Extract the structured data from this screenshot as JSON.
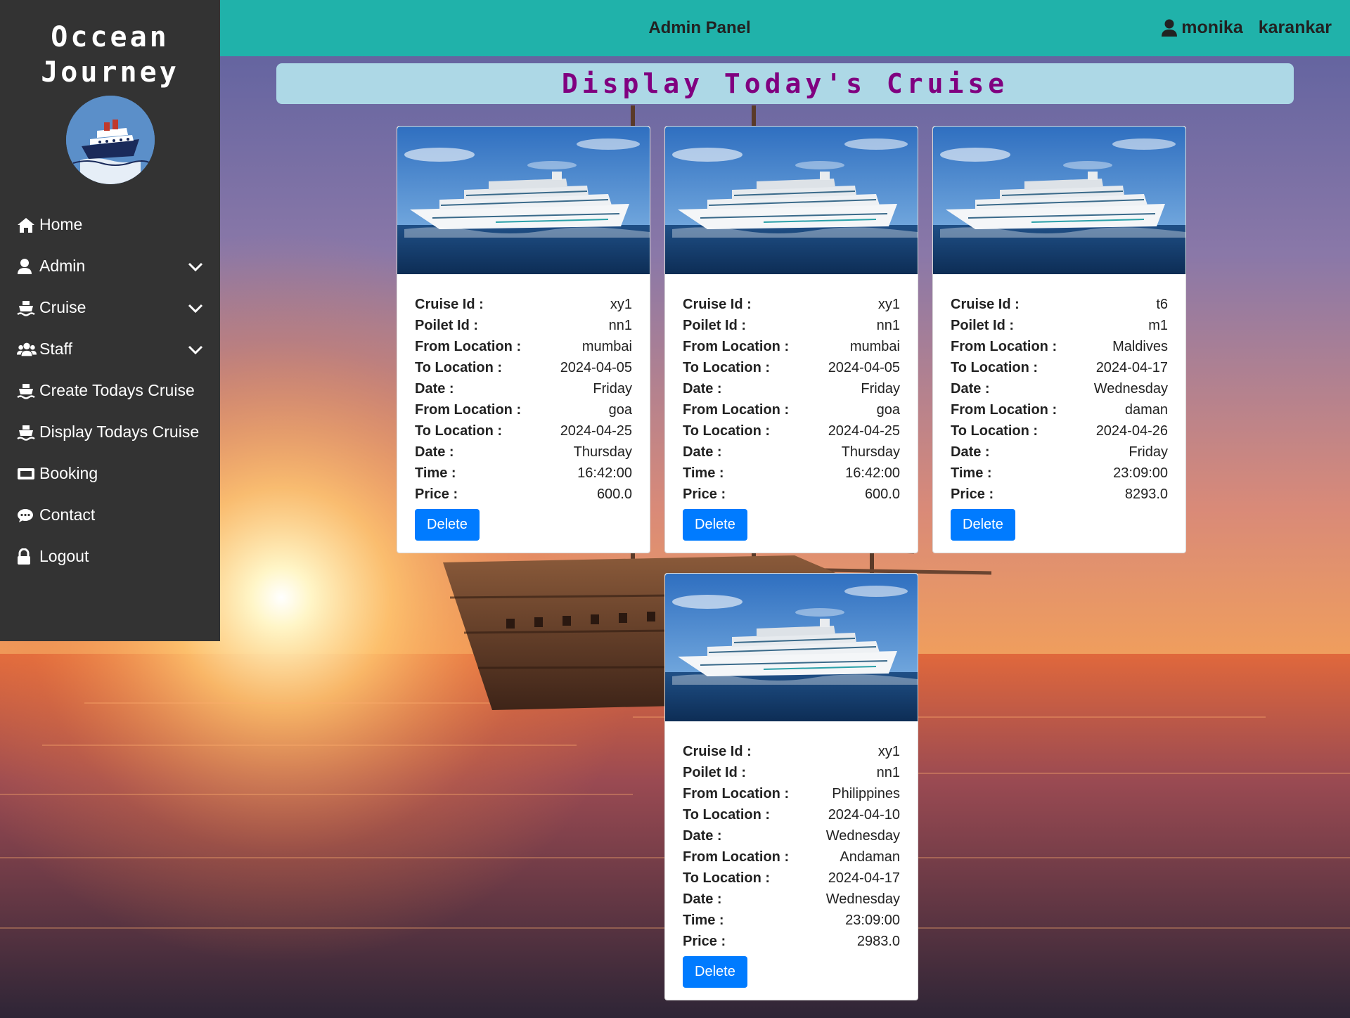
{
  "brand": {
    "line1": "Occean",
    "line2": "Journey"
  },
  "nav": [
    {
      "label": "Home",
      "icon": "home-icon",
      "dropdown": false
    },
    {
      "label": "Admin",
      "icon": "user-icon",
      "dropdown": true
    },
    {
      "label": "Cruise",
      "icon": "ship-icon",
      "dropdown": true
    },
    {
      "label": "Staff",
      "icon": "users-icon",
      "dropdown": true
    },
    {
      "label": "Create Todays Cruise",
      "icon": "ship-icon",
      "dropdown": false
    },
    {
      "label": "Display Todays Cruise",
      "icon": "ship-icon",
      "dropdown": false
    },
    {
      "label": "Booking",
      "icon": "ticket-icon",
      "dropdown": false
    },
    {
      "label": "Contact",
      "icon": "chat-icon",
      "dropdown": false
    },
    {
      "label": "Logout",
      "icon": "lock-icon",
      "dropdown": false
    }
  ],
  "topbar": {
    "title": "Admin Panel",
    "user_first": "monika",
    "user_last": "karankar"
  },
  "page": {
    "heading": "Display Today's Cruise"
  },
  "labels": {
    "cruise_id": "Cruise Id :",
    "poilet_id": "Poilet Id :",
    "from_location": "From Location :",
    "to_location": "To Location :",
    "date": "Date :",
    "time": "Time :",
    "price": "Price :",
    "delete": "Delete"
  },
  "cruises": [
    {
      "cruise_id": "xy1",
      "poilet_id": "nn1",
      "from1": "mumbai",
      "to1": "2024-04-05",
      "date1": "Friday",
      "from2": "goa",
      "to2": "2024-04-25",
      "date2": "Thursday",
      "time": "16:42:00",
      "price": "600.0"
    },
    {
      "cruise_id": "xy1",
      "poilet_id": "nn1",
      "from1": "mumbai",
      "to1": "2024-04-05",
      "date1": "Friday",
      "from2": "goa",
      "to2": "2024-04-25",
      "date2": "Thursday",
      "time": "16:42:00",
      "price": "600.0"
    },
    {
      "cruise_id": "t6",
      "poilet_id": "m1",
      "from1": "Maldives",
      "to1": "2024-04-17",
      "date1": "Wednesday",
      "from2": "daman",
      "to2": "2024-04-26",
      "date2": "Friday",
      "time": "23:09:00",
      "price": "8293.0"
    },
    {
      "cruise_id": "xy1",
      "poilet_id": "nn1",
      "from1": "Philippines",
      "to1": "2024-04-10",
      "date1": "Wednesday",
      "from2": "Andaman",
      "to2": "2024-04-17",
      "date2": "Wednesday",
      "time": "23:09:00",
      "price": "2983.0"
    }
  ],
  "colors": {
    "sidebar": "#333333",
    "topbar": "#20b2aa",
    "banner": "#add8e6",
    "heading": "#800080",
    "button": "#007bff"
  }
}
